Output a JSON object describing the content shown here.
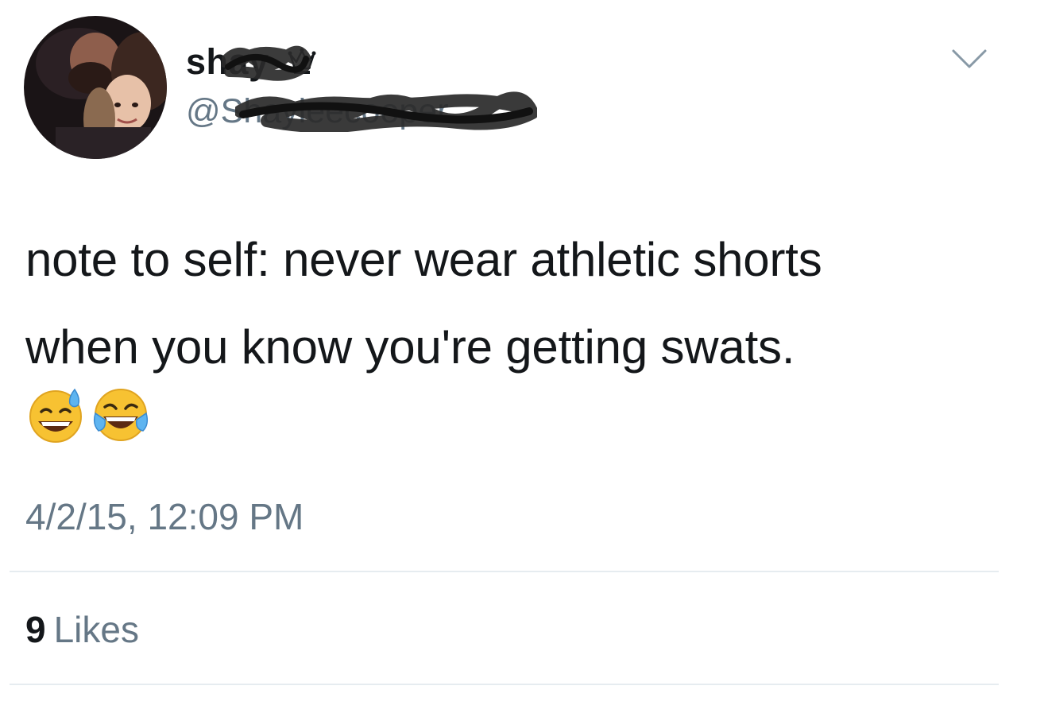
{
  "tweet": {
    "display_name": "shay",
    "handle": "@Shayleecooper",
    "text": "note to self: never wear athletic shorts\nwhen you know you're getting swats.",
    "emojis": [
      "sweat-smile-emoji",
      "tears-of-joy-emoji"
    ],
    "timestamp": "4/2/15, 12:09 PM",
    "likes_count": "9",
    "likes_label": "Likes"
  },
  "icons": {
    "menu": "chevron-down-icon",
    "badge": "crown-icon"
  },
  "colors": {
    "primary_text": "#14171a",
    "secondary_text": "#657786",
    "divider": "#e6ecf0",
    "background": "#ffffff"
  }
}
